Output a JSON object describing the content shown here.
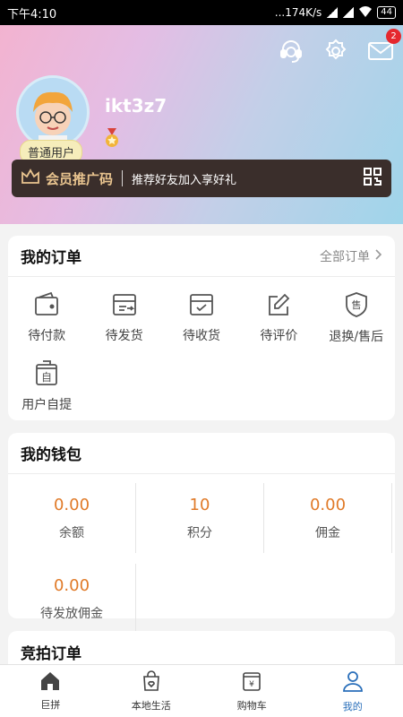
{
  "status_bar": {
    "time": "下午4:10",
    "network": "...174K/s",
    "battery": "44"
  },
  "header": {
    "username": "ikt3z7",
    "user_level": "普通用户",
    "mail_badge": "2"
  },
  "promo": {
    "title": "会员推广码",
    "subtitle": "推荐好友加入享好礼"
  },
  "orders": {
    "title": "我的订单",
    "all_link": "全部订单",
    "items": [
      {
        "label": "待付款",
        "icon": "wallet-icon"
      },
      {
        "label": "待发货",
        "icon": "box-send-icon"
      },
      {
        "label": "待收货",
        "icon": "box-receive-icon"
      },
      {
        "label": "待评价",
        "icon": "edit-icon"
      },
      {
        "label": "退换/售后",
        "icon": "shield-service-icon"
      },
      {
        "label": "用户自提",
        "icon": "pickup-icon"
      }
    ]
  },
  "wallet": {
    "title": "我的钱包",
    "items": [
      {
        "value": "0.00",
        "label": "余额"
      },
      {
        "value": "10",
        "label": "积分"
      },
      {
        "value": "0.00",
        "label": "佣金"
      },
      {
        "value": "0.00",
        "label": "待发放佣金"
      }
    ]
  },
  "auction": {
    "title": "竞拍订单"
  },
  "tabbar": {
    "items": [
      {
        "label": "巨拼",
        "icon": "home-icon"
      },
      {
        "label": "本地生活",
        "icon": "bag-icon"
      },
      {
        "label": "购物车",
        "icon": "cart-icon"
      },
      {
        "label": "我的",
        "icon": "user-icon",
        "active": true
      }
    ]
  },
  "colors": {
    "accent": "#2a6fba",
    "value": "#e07a28",
    "promo_bg": "#3a2e2b",
    "badge": "#e5282e"
  }
}
